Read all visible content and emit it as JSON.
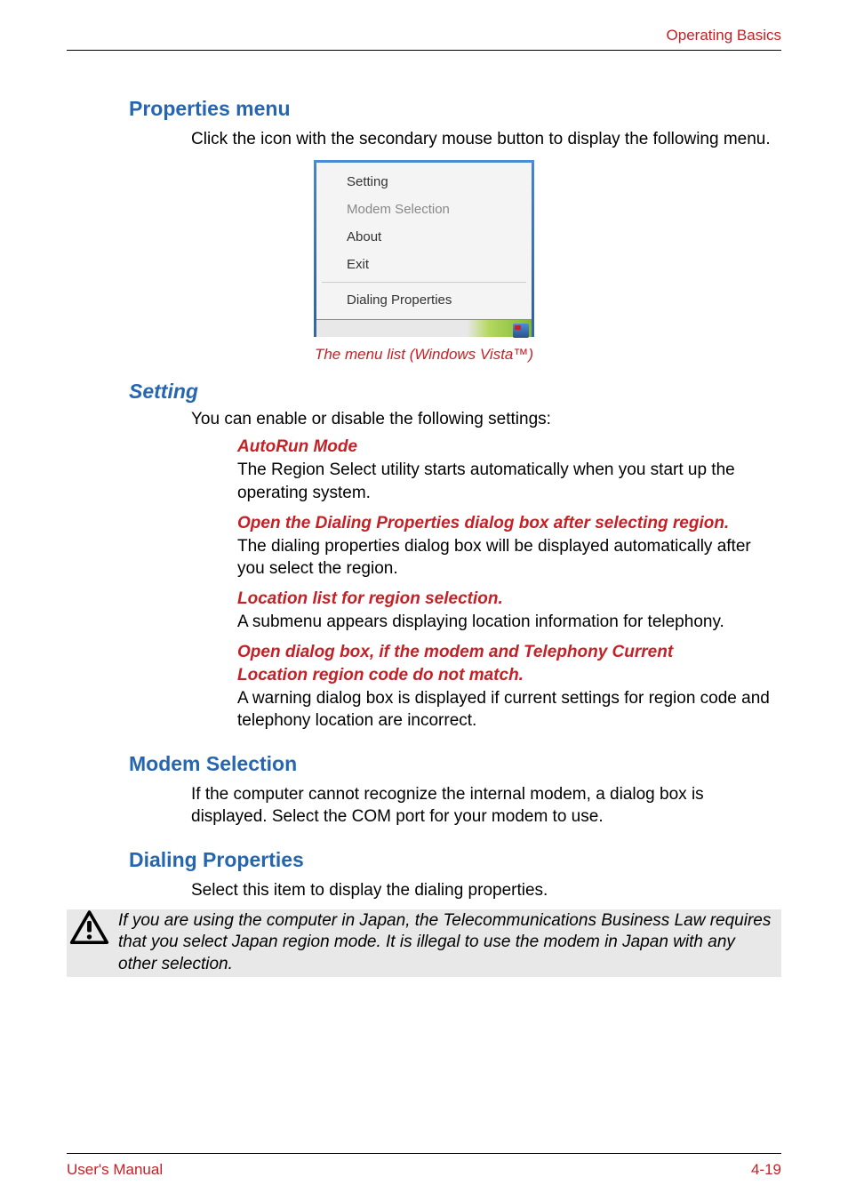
{
  "header": {
    "title": "Operating Basics"
  },
  "section1": {
    "heading": "Properties menu",
    "body": "Click the icon with the secondary mouse button to display the following menu."
  },
  "menu": {
    "item1": "Setting",
    "item2": "Modem Selection",
    "item3": "About",
    "item4": "Exit",
    "item5": "Dialing Properties"
  },
  "caption": "The menu list (Windows Vista™)",
  "setting": {
    "heading": "Setting",
    "intro": "You can enable or disable the following settings:",
    "autorun_title": "AutoRun Mode",
    "autorun_body": "The Region Select utility starts automatically when you start up the operating system.",
    "open_dial_title": "Open the Dialing Properties dialog box after selecting region.",
    "open_dial_body": "The dialing properties dialog box will be displayed automatically after you select the region.",
    "location_title": "Location list for region selection.",
    "location_body": "A submenu appears displaying location information for telephony.",
    "open_box_title": "Open dialog box, if the modem and Telephony Current",
    "location_region_title": "Location region code do not match.",
    "location_region_body": "A warning dialog box is displayed if current settings for region code and telephony location are incorrect."
  },
  "modem": {
    "heading": "Modem Selection",
    "body": "If the computer cannot recognize the internal modem, a dialog box is displayed. Select the COM port for your modem to use."
  },
  "dialing": {
    "heading": "Dialing Properties",
    "body": "Select this item to display the dialing properties."
  },
  "warning": {
    "text": "If you are using the computer in Japan, the Telecommunications Business Law requires that you select Japan region mode. It is illegal to use the modem in Japan with any other selection."
  },
  "footer": {
    "left": "User's Manual",
    "right": "4-19"
  }
}
